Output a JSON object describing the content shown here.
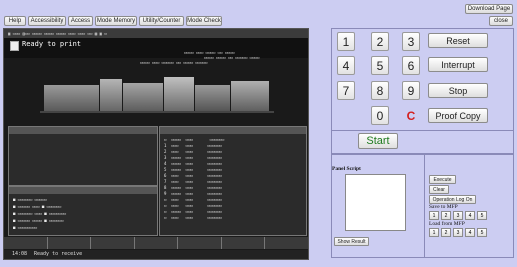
{
  "header": {
    "download_label": "Download Page",
    "close_label": "close"
  },
  "tabs": [
    {
      "label": "Help"
    },
    {
      "label": "Accessibility"
    },
    {
      "label": "Access"
    },
    {
      "label": "Mode Memory"
    },
    {
      "label": "Utility/Counter"
    },
    {
      "label": "Mode Check"
    }
  ],
  "screen": {
    "status_title": "Ready to print",
    "footer_time": "14:08",
    "footer_status": "Ready to receive",
    "job_panel_title": "",
    "output_panel_title": "",
    "consumables_title": ""
  },
  "keypad": {
    "keys": [
      "1",
      "2",
      "3",
      "4",
      "5",
      "6",
      "7",
      "8",
      "9",
      "0"
    ],
    "clear_symbol": "C"
  },
  "controls": {
    "reset": "Reset",
    "interrupt": "Interrupt",
    "stop": "Stop",
    "proof_copy": "Proof Copy",
    "start": "Start"
  },
  "script_panel": {
    "title": "Panel Script",
    "textarea_value": "",
    "execute": "Execute",
    "clear": "Clear",
    "operation_log_on": "Operation Log On",
    "save_to_mfp": "Save to MFP",
    "load_from_mfp": "Load from MFP",
    "slots": [
      "1",
      "2",
      "3",
      "4",
      "5"
    ],
    "show_result": "Show Result"
  },
  "colors": {
    "background": "#cccdf2",
    "start_green": "#1f7a1f",
    "clear_red": "#d42020"
  }
}
